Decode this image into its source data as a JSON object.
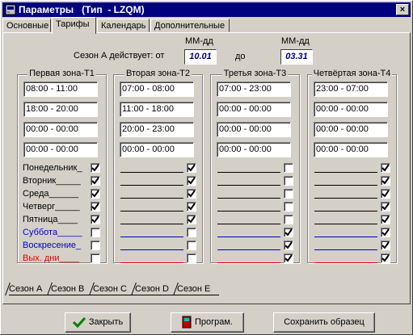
{
  "window": {
    "title": "Параметры   (Тип  - LZQM)",
    "close": "×"
  },
  "tabs": [
    {
      "label": "Основные"
    },
    {
      "label": "Тарифы"
    },
    {
      "label": "Календарь"
    },
    {
      "label": "Дополнительные"
    }
  ],
  "season": {
    "from_format": "ММ-дд",
    "to_format": "ММ-дд",
    "label": "Сезон А  действует: от",
    "to_label": "до",
    "from_value": "10.01",
    "to_value": "03.31"
  },
  "zones": [
    {
      "title": "Первая зона-Т1",
      "intervals": [
        "08:00 - 11:00",
        "18:00 - 20:00",
        "00:00 - 00:00",
        "00:00 - 00:00"
      ]
    },
    {
      "title": "Вторая зона-Т2",
      "intervals": [
        "07:00 - 08:00",
        "11:00 - 18:00",
        "20:00 - 23:00",
        "00:00 - 00:00"
      ]
    },
    {
      "title": "Третья зона-Т3",
      "intervals": [
        "07:00 - 23:00",
        "00:00 - 00:00",
        "00:00 - 00:00",
        "00:00 - 00:00"
      ]
    },
    {
      "title": "Четвёртая зона-Т4",
      "intervals": [
        "23:00 - 07:00",
        "00:00 - 00:00",
        "00:00 - 00:00",
        "00:00 - 00:00"
      ]
    }
  ],
  "days": [
    {
      "label": "Понедельник_",
      "color": "#000000"
    },
    {
      "label": "Вторник_____",
      "color": "#000000"
    },
    {
      "label": "Среда______",
      "color": "#000000"
    },
    {
      "label": "Четверг_____",
      "color": "#000000"
    },
    {
      "label": "Пятница____",
      "color": "#000000"
    },
    {
      "label": "Суббота_____",
      "color": "#0000c0"
    },
    {
      "label": "Воскресение_",
      "color": "#0000c0"
    },
    {
      "label": "Вых. дни____",
      "color": "#e00000"
    }
  ],
  "checks": [
    [
      true,
      true,
      true,
      true,
      true,
      false,
      false,
      false
    ],
    [
      true,
      true,
      true,
      true,
      true,
      false,
      false,
      false
    ],
    [
      false,
      false,
      false,
      false,
      false,
      true,
      true,
      true
    ],
    [
      true,
      true,
      true,
      true,
      true,
      true,
      true,
      true
    ]
  ],
  "season_tabs": [
    "Сезон А",
    "Сезон В",
    "Сезон С",
    "Сезон D",
    "Сезон Е"
  ],
  "buttons": {
    "close": "Закрыть",
    "program": "Програм.",
    "save": "Сохранить образец"
  }
}
